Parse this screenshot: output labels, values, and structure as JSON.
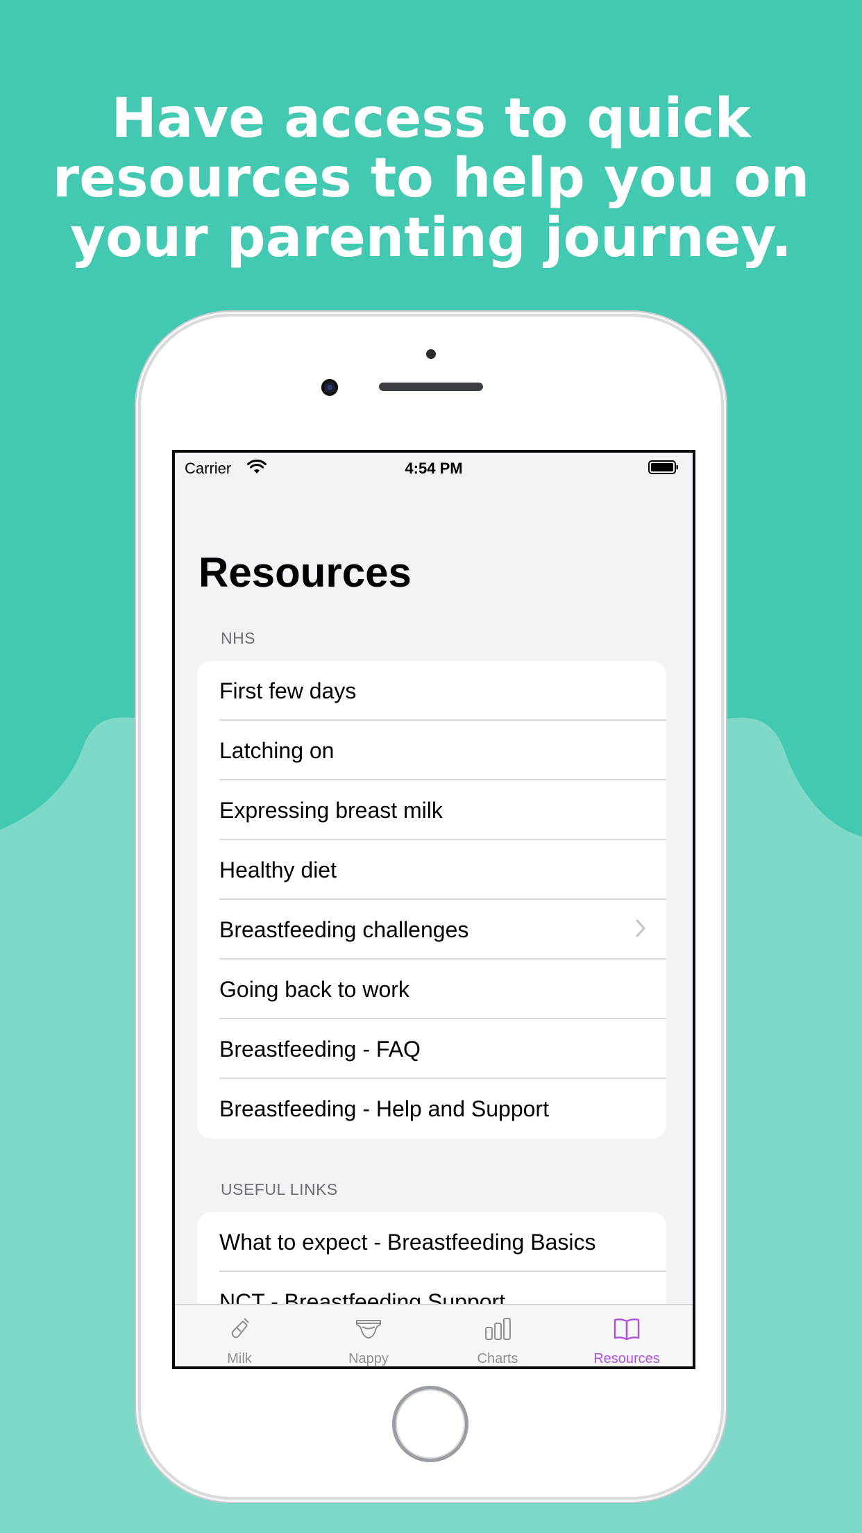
{
  "headline": {
    "line1": "Have access to quick",
    "line2": "resources to help you on",
    "line3": "your parenting journey."
  },
  "colors": {
    "background_top": "#43c8b1",
    "background_wave": "#7fd9c8",
    "accent": "#af52de"
  },
  "status_bar": {
    "carrier": "Carrier",
    "time": "4:54 PM"
  },
  "screen": {
    "title": "Resources",
    "sections": [
      {
        "header": "NHS",
        "items": [
          {
            "label": "First few days"
          },
          {
            "label": "Latching on"
          },
          {
            "label": "Expressing breast milk"
          },
          {
            "label": "Healthy diet"
          },
          {
            "label": "Breastfeeding challenges"
          },
          {
            "label": "Going back to work"
          },
          {
            "label": "Breastfeeding - FAQ"
          },
          {
            "label": "Breastfeeding - Help and Support"
          }
        ]
      },
      {
        "header": "USEFUL LINKS",
        "items": [
          {
            "label": "What to expect - Breastfeeding Basics"
          },
          {
            "label": "NCT - Breastfeeding Support"
          }
        ]
      }
    ]
  },
  "tab_bar": {
    "tabs": [
      {
        "label": "Milk",
        "icon": "bottle-icon"
      },
      {
        "label": "Nappy",
        "icon": "nappy-icon"
      },
      {
        "label": "Charts",
        "icon": "bar-chart-icon"
      },
      {
        "label": "Resources",
        "icon": "book-icon",
        "selected": true
      }
    ]
  }
}
